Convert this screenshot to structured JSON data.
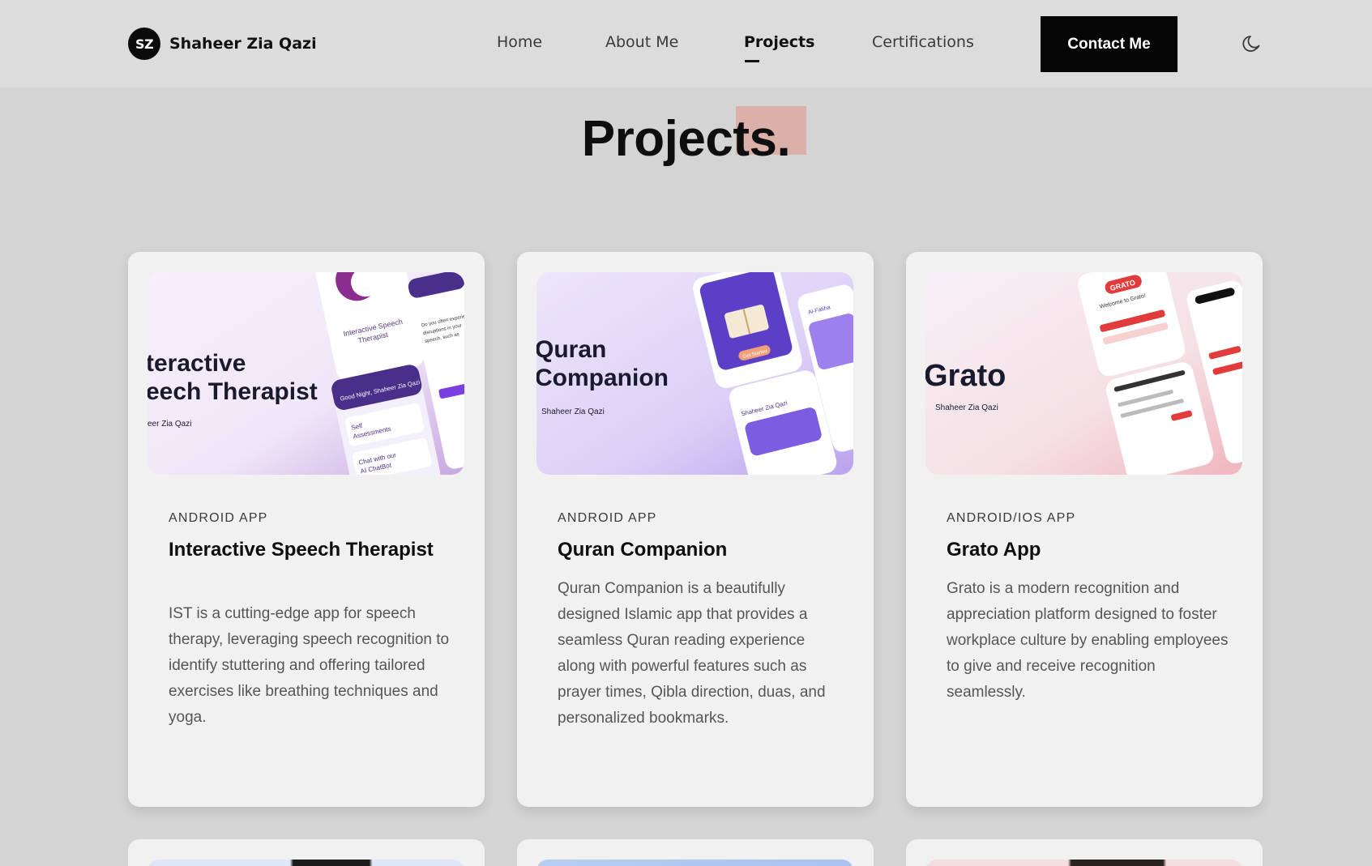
{
  "header": {
    "logo_initials": "SZ",
    "brand_name": "Shaheer Zia Qazi",
    "nav": {
      "home": "Home",
      "about": "About Me",
      "projects": "Projects",
      "certifications": "Certifications"
    },
    "contact_label": "Contact Me",
    "theme_icon": "moon-icon"
  },
  "page_title": "Projects.",
  "colors": {
    "page_bg": "#d4d4d4",
    "header_bg": "#dcdcdc",
    "card_bg": "#f1f1f1",
    "title_accent": "#dab0a8",
    "button_bg": "#050505"
  },
  "projects": [
    {
      "category": "ANDROID APP",
      "title": "Interactive Speech Therapist",
      "description": "IST is a cutting-edge app for speech therapy, leveraging speech recognition to identify stuttering and offering tailored exercises like breathing techniques and yoga.",
      "thumbnail": {
        "line1": "teractive",
        "line2": "eech Therapist",
        "author": "eer Zia Qazi",
        "phone_text_a": "Interactive Speech Therapist",
        "phone_text_b": "Good Night, Shaheer Zia Qazi",
        "phone_text_c": "Self Assessments",
        "phone_text_d": "Chat with our AI ChatBot"
      }
    },
    {
      "category": "ANDROID APP",
      "title": "Quran Companion",
      "description": "Quran Companion is a beautifully designed Islamic app that provides a seamless Quran reading experience along with powerful features such as prayer times, Qibla direction, duas, and personalized bookmarks.",
      "thumbnail": {
        "line1": "Quran",
        "line2": "Companion",
        "author": "Shaheer Zia Qazi",
        "phone_text_a": "Get Started",
        "phone_text_b": "Al-Fatiha",
        "phone_text_c": "Shaheer Zia Qazi"
      }
    },
    {
      "category": "ANDROID/IOS APP",
      "title": "Grato App",
      "description": "Grato is a modern recognition and appreciation platform designed to foster workplace culture by enabling employees to give and receive recognition seamlessly.",
      "thumbnail": {
        "line1": "Grato",
        "author": "Shaheer Zia Qazi",
        "phone_text_a": "GRATO",
        "phone_text_b": "Welcome to Grato!"
      }
    }
  ]
}
